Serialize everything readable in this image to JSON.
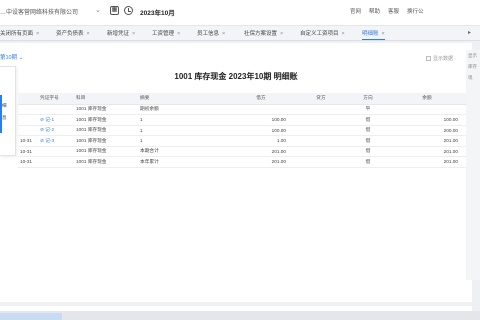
{
  "topbar": {
    "company": "…中设客营网络科技有限公司",
    "period": "2023年10月",
    "links": [
      "官网",
      "帮助",
      "客服",
      "换行公"
    ]
  },
  "tabs": [
    {
      "label": "关闭所有页面"
    },
    {
      "label": "资产负债表"
    },
    {
      "label": "新增凭证"
    },
    {
      "label": "工资管理"
    },
    {
      "label": "员工信息"
    },
    {
      "label": "社保方案设置"
    },
    {
      "label": "自定义工资项目"
    },
    {
      "label": "明细账"
    }
  ],
  "period_select": "第10期",
  "dropdown_items": [
    "细",
    "息"
  ],
  "show_toggle": "显示数据",
  "ledger_title": "1001 库存现金 2023年10期 明细账",
  "table": {
    "headers": [
      "",
      "凭证字号",
      "科目",
      "摘要",
      "借方",
      "贷方",
      "方向",
      "余额"
    ],
    "rows": [
      [
        "",
        "",
        "1001 库存现金",
        "期初余额",
        "",
        "",
        "平",
        ""
      ],
      [
        "",
        "记-1",
        "1001 库存现金",
        "1",
        "100.00",
        "",
        "借",
        "100.00"
      ],
      [
        "",
        "记-2",
        "1001 库存现金",
        "1",
        "100.00",
        "",
        "借",
        "200.00"
      ],
      [
        "10-31",
        "记-3",
        "1001 库存现金",
        "1",
        "1.00",
        "",
        "借",
        "201.00"
      ],
      [
        "10-31",
        "",
        "1001 库存现金",
        "本期合计",
        "201.00",
        "",
        "借",
        "201.00"
      ],
      [
        "10-31",
        "",
        "1001 库存现金",
        "本年累计",
        "201.00",
        "",
        "借",
        "201.00"
      ]
    ]
  },
  "right_panel": [
    "显示",
    "库存现"
  ],
  "colors": {
    "accent": "#2f7de1",
    "header_bg": "#f3f4f7"
  }
}
